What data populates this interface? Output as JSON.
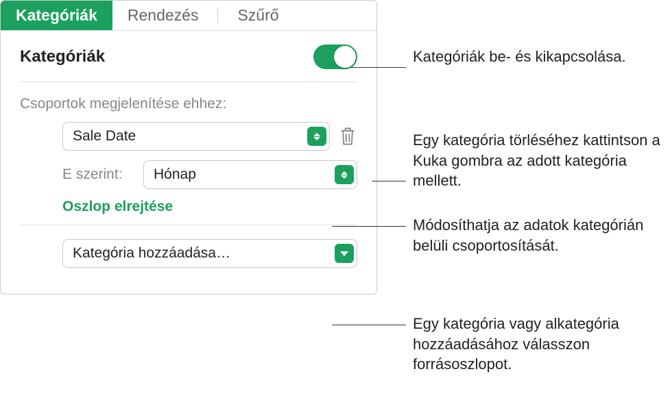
{
  "tabs": {
    "categories": "Kategóriák",
    "sort": "Rendezés",
    "filter": "Szűrő"
  },
  "section": {
    "title": "Kategóriák",
    "group_label": "Csoportok megjelenítése ehhez:",
    "group_value": "Sale Date",
    "by_label": "E szerint:",
    "by_value": "Hónap",
    "hide_column": "Oszlop elrejtése",
    "add_category": "Kategória hozzáadása…"
  },
  "callouts": {
    "toggle": "Kategóriák be- és kikapcsolása.",
    "delete": "Egy kategória törléséhez kattintson a Kuka gombra az adott kategória mellett.",
    "grouping": "Módosíthatja az adatok kategórián belüli csoportosítását.",
    "add": "Egy kategória vagy alkategória hozzáadásához válasszon forrásoszlopot."
  }
}
